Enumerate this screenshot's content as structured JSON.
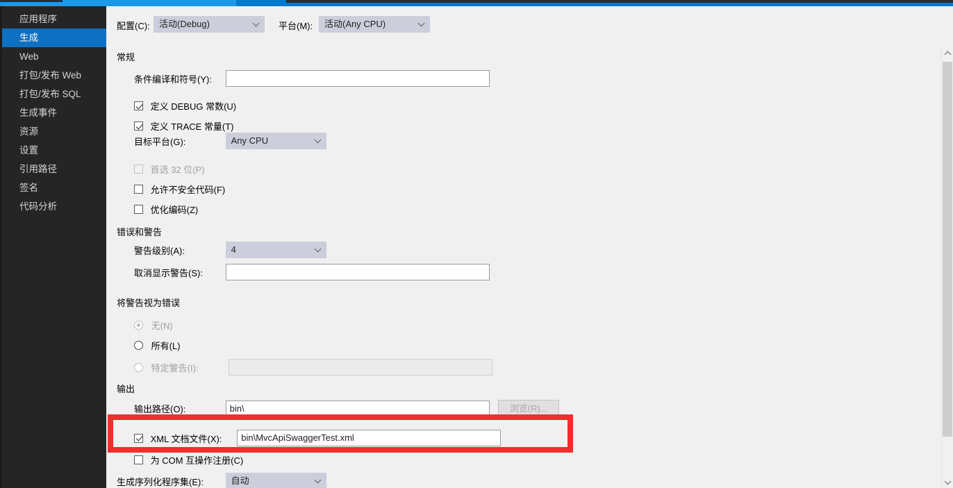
{
  "sidebar": {
    "items": [
      {
        "label": "应用程序",
        "selected": false
      },
      {
        "label": "生成",
        "selected": true
      },
      {
        "label": "Web",
        "selected": false
      },
      {
        "label": "打包/发布 Web",
        "selected": false
      },
      {
        "label": "打包/发布 SQL",
        "selected": false
      },
      {
        "label": "生成事件",
        "selected": false
      },
      {
        "label": "资源",
        "selected": false
      },
      {
        "label": "设置",
        "selected": false
      },
      {
        "label": "引用路径",
        "selected": false
      },
      {
        "label": "签名",
        "selected": false
      },
      {
        "label": "代码分析",
        "selected": false
      }
    ]
  },
  "config_row": {
    "configuration_label": "配置(C):",
    "configuration_value": "活动(Debug)",
    "platform_label": "平台(M):",
    "platform_value": "活动(Any CPU)"
  },
  "sections": {
    "general": "常规",
    "errors_warnings": "错误和警告",
    "treat_warnings_as_errors": "将警告视为错误",
    "output": "输出"
  },
  "general": {
    "conditional_symbols_label": "条件编译和符号(Y):",
    "conditional_symbols_value": "",
    "define_debug_label": "定义 DEBUG 常数(U)",
    "define_debug_checked": true,
    "define_trace_label": "定义 TRACE 常量(T)",
    "define_trace_checked": true,
    "target_platform_label": "目标平台(G):",
    "target_platform_value": "Any CPU",
    "prefer_32bit_label": "首选 32 位(P)",
    "prefer_32bit_checked": false,
    "allow_unsafe_label": "允许不安全代码(F)",
    "allow_unsafe_checked": false,
    "optimize_label": "优化编码(Z)",
    "optimize_checked": false
  },
  "errors_warnings": {
    "warning_level_label": "警告级别(A):",
    "warning_level_value": "4",
    "suppress_warnings_label": "取消显示警告(S):",
    "suppress_warnings_value": ""
  },
  "treat_warnings": {
    "none_label": "无(N)",
    "none_selected": true,
    "all_label": "所有(L)",
    "all_selected": false,
    "specific_label": "特定警告(I):",
    "specific_selected": false,
    "specific_value": ""
  },
  "output": {
    "output_path_label": "输出路径(O):",
    "output_path_value": "bin\\",
    "browse_button_label": "浏览(R)...",
    "xml_doc_label": "XML 文档文件(X):",
    "xml_doc_checked": true,
    "xml_doc_value": "bin\\MvcApiSwaggerTest.xml",
    "com_interop_label": "为 COM 互操作注册(C)",
    "com_interop_checked": false,
    "serialization_label": "生成序列化程序集(E):",
    "serialization_value": "自动"
  },
  "annotation": {
    "highlight_color": "#f22d2d"
  }
}
